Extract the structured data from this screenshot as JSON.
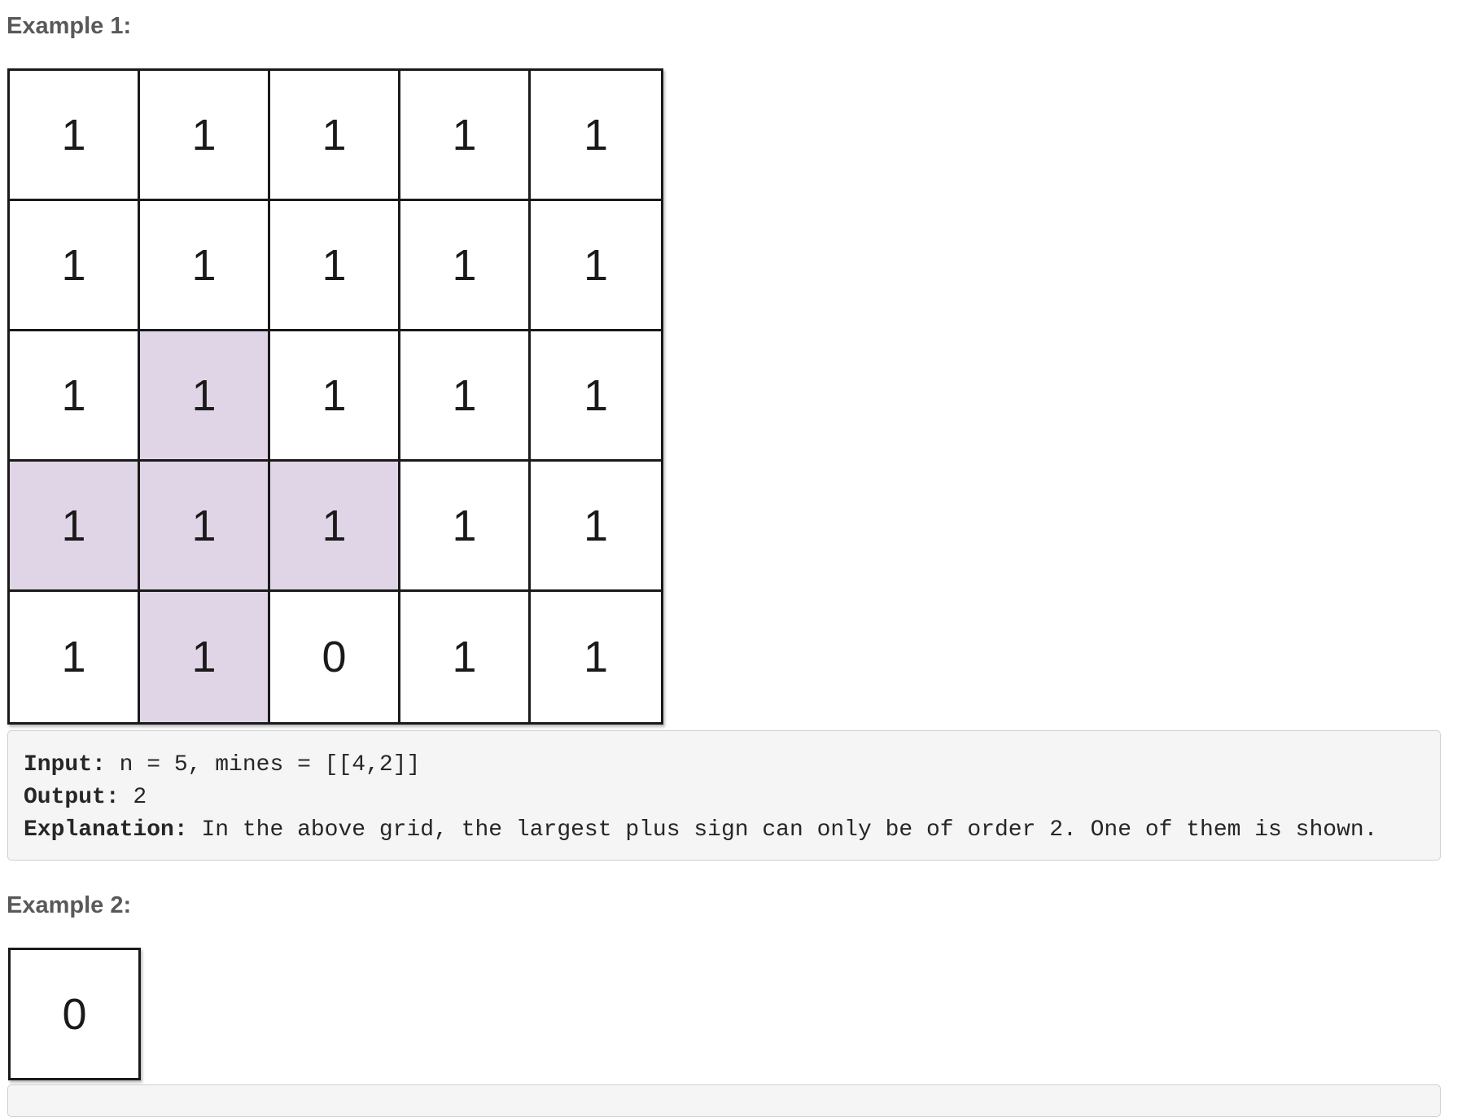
{
  "example1": {
    "heading": "Example 1:",
    "grid": [
      [
        "1",
        "1",
        "1",
        "1",
        "1"
      ],
      [
        "1",
        "1",
        "1",
        "1",
        "1"
      ],
      [
        "1",
        "1",
        "1",
        "1",
        "1"
      ],
      [
        "1",
        "1",
        "1",
        "1",
        "1"
      ],
      [
        "1",
        "1",
        "0",
        "1",
        "1"
      ]
    ],
    "highlighted_cells": [
      [
        2,
        1
      ],
      [
        3,
        0
      ],
      [
        3,
        1
      ],
      [
        3,
        2
      ],
      [
        4,
        1
      ]
    ],
    "highlight_color": "#e0d5e6",
    "input_label": "Input:",
    "input_value": " n = 5, mines = [[4,2]]",
    "output_label": "Output:",
    "output_value": " 2",
    "explanation_label": "Explanation:",
    "explanation_value": " In the above grid, the largest plus sign can only be of order 2. One of them is shown."
  },
  "example2": {
    "heading": "Example 2:",
    "grid": [
      [
        "0"
      ]
    ],
    "highlighted_cells": []
  }
}
